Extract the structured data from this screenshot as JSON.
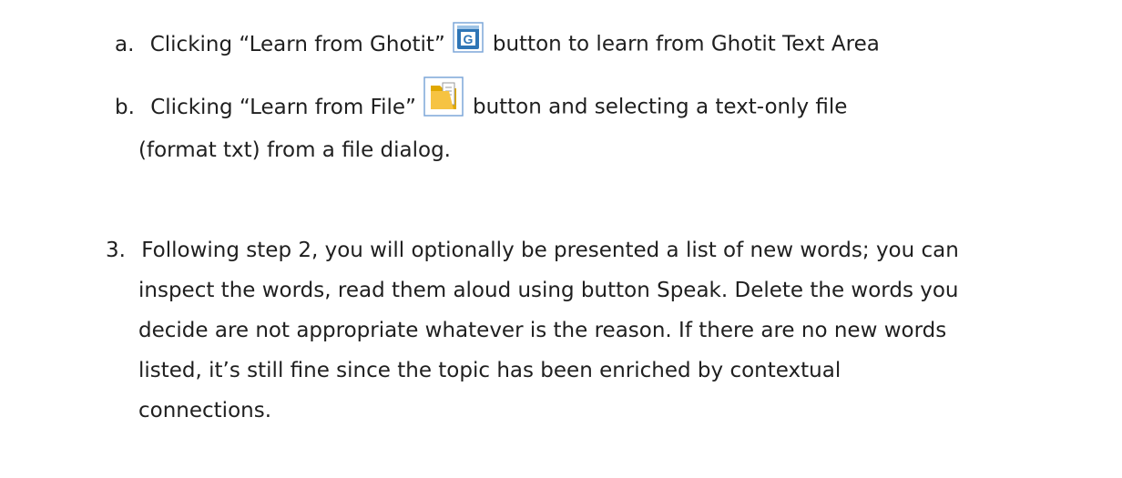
{
  "steps": {
    "a": {
      "marker": "a.",
      "before": "Clicking “Learn from Ghotit”",
      "icon": "ghotit-learn-icon",
      "after": "button to learn from Ghotit Text Area"
    },
    "b": {
      "marker": "b.",
      "before": "Clicking “Learn from File”",
      "icon": "folder-file-icon",
      "after": "button and selecting a text-only file",
      "line2": "(format txt) from a file dialog."
    },
    "three": {
      "marker": "3.",
      "lines": [
        "Following step 2, you will optionally be presented a list of new words; you can",
        "inspect the words, read them aloud using button Speak. Delete the words you",
        "decide are not appropriate whatever is the reason. If there are no new words",
        "listed, it’s still fine since the topic has been enriched by contextual",
        "connections."
      ]
    }
  },
  "colors": {
    "text": "#1f1f1f",
    "ghotit_icon_blue": "#2e75b6",
    "folder_yellow": "#f6c342"
  }
}
